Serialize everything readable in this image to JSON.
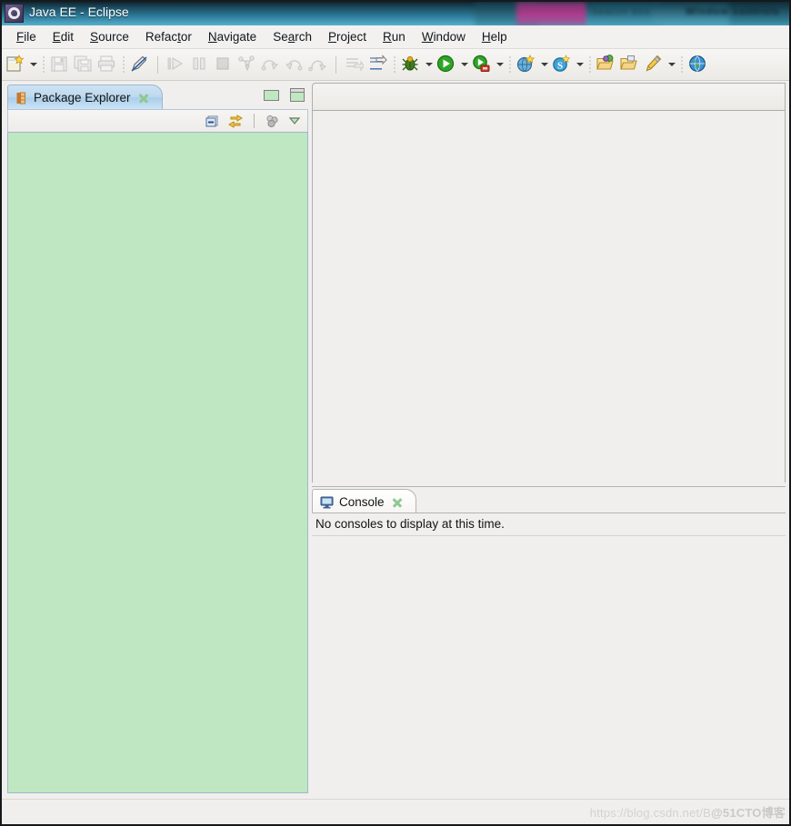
{
  "window": {
    "title": "Java EE - Eclipse",
    "app_icon": "eclipse-icon",
    "titlebar_blurred_text_1": "Search box",
    "titlebar_blurred_text_2": "Window controls"
  },
  "menubar": {
    "items": [
      {
        "label": "File",
        "mnemonic": "F",
        "name": "menu-file"
      },
      {
        "label": "Edit",
        "mnemonic": "E",
        "name": "menu-edit"
      },
      {
        "label": "Source",
        "mnemonic": "S",
        "name": "menu-source"
      },
      {
        "label": "Refactor",
        "mnemonic": "t",
        "name": "menu-refactor"
      },
      {
        "label": "Navigate",
        "mnemonic": "N",
        "name": "menu-navigate"
      },
      {
        "label": "Search",
        "mnemonic": "a",
        "name": "menu-search"
      },
      {
        "label": "Project",
        "mnemonic": "P",
        "name": "menu-project"
      },
      {
        "label": "Run",
        "mnemonic": "R",
        "name": "menu-run"
      },
      {
        "label": "Window",
        "mnemonic": "W",
        "name": "menu-window"
      },
      {
        "label": "Help",
        "mnemonic": "H",
        "name": "menu-help"
      }
    ]
  },
  "toolbar": {
    "items": [
      {
        "name": "new-wizard-button",
        "icon": "new-file-icon",
        "enabled": true,
        "dropdown": true
      },
      {
        "name": "separator-1",
        "icon": "dotted-separator",
        "enabled": true,
        "dropdown": false
      },
      {
        "name": "save-button",
        "icon": "save-icon",
        "enabled": false,
        "dropdown": false
      },
      {
        "name": "save-all-button",
        "icon": "save-all-icon",
        "enabled": false,
        "dropdown": false
      },
      {
        "name": "print-button",
        "icon": "print-icon",
        "enabled": false,
        "dropdown": false
      },
      {
        "name": "separator-2",
        "icon": "dotted-separator",
        "enabled": true,
        "dropdown": false
      },
      {
        "name": "quick-access-button",
        "icon": "pen-icon",
        "enabled": true,
        "dropdown": false
      },
      {
        "name": "separator-3",
        "icon": "solid-separator",
        "enabled": true,
        "dropdown": false
      },
      {
        "name": "resume-button",
        "icon": "resume-icon",
        "enabled": false,
        "dropdown": false
      },
      {
        "name": "suspend-button",
        "icon": "suspend-icon",
        "enabled": false,
        "dropdown": false
      },
      {
        "name": "terminate-button",
        "icon": "terminate-icon",
        "enabled": false,
        "dropdown": false
      },
      {
        "name": "step-into-button",
        "icon": "step-into-icon",
        "enabled": false,
        "dropdown": false
      },
      {
        "name": "step-over-button",
        "icon": "step-over-icon",
        "enabled": false,
        "dropdown": false
      },
      {
        "name": "step-return-button",
        "icon": "step-return-icon",
        "enabled": false,
        "dropdown": false
      },
      {
        "name": "drop-to-frame-button",
        "icon": "drop-to-frame-icon",
        "enabled": false,
        "dropdown": false
      },
      {
        "name": "separator-4",
        "icon": "solid-separator",
        "enabled": true,
        "dropdown": false
      },
      {
        "name": "skip-breakpoints-button",
        "icon": "skip-breakpoints-icon",
        "enabled": false,
        "dropdown": false
      },
      {
        "name": "use-step-filters-button",
        "icon": "step-filters-icon",
        "enabled": true,
        "dropdown": false
      },
      {
        "name": "separator-5",
        "icon": "dotted-separator",
        "enabled": true,
        "dropdown": false
      },
      {
        "name": "debug-button",
        "icon": "debug-bug-icon",
        "enabled": true,
        "dropdown": true
      },
      {
        "name": "run-button",
        "icon": "run-play-icon",
        "enabled": true,
        "dropdown": true
      },
      {
        "name": "run-on-server-button",
        "icon": "run-on-server-icon",
        "enabled": true,
        "dropdown": true
      },
      {
        "name": "separator-6",
        "icon": "dotted-separator",
        "enabled": true,
        "dropdown": false
      },
      {
        "name": "new-web-project-button",
        "icon": "new-web-project-icon",
        "enabled": true,
        "dropdown": true
      },
      {
        "name": "search-button",
        "icon": "search-s-icon",
        "enabled": true,
        "dropdown": true
      },
      {
        "name": "separator-7",
        "icon": "dotted-separator",
        "enabled": true,
        "dropdown": false
      },
      {
        "name": "open-type-button",
        "icon": "open-folder-green-icon",
        "enabled": true,
        "dropdown": false
      },
      {
        "name": "open-task-button",
        "icon": "open-folder-icon",
        "enabled": true,
        "dropdown": false
      },
      {
        "name": "annotation-button",
        "icon": "pencil-icon",
        "enabled": true,
        "dropdown": true
      },
      {
        "name": "separator-8",
        "icon": "dotted-separator",
        "enabled": true,
        "dropdown": false
      },
      {
        "name": "open-browser-button",
        "icon": "globe-icon",
        "enabled": true,
        "dropdown": false
      }
    ]
  },
  "package_explorer": {
    "tab_label": "Package Explorer",
    "tab_icon": "package-explorer-icon",
    "close_icon": "close-icon",
    "minimize_icon": "minimize-icon",
    "maximize_icon": "maximize-icon",
    "toolbar": [
      {
        "name": "collapse-all-button",
        "icon": "collapse-all-icon"
      },
      {
        "name": "link-with-editor-button",
        "icon": "link-with-editor-icon"
      },
      {
        "name": "view-separator",
        "icon": "separator"
      },
      {
        "name": "focus-on-active-button",
        "icon": "focus-task-icon"
      },
      {
        "name": "view-menu-button",
        "icon": "chevron-down-icon"
      }
    ],
    "tree_items": [],
    "background_color": "#bfe7c2"
  },
  "editor": {
    "tabs": [],
    "content": ""
  },
  "console": {
    "tab_label": "Console",
    "tab_icon": "console-monitor-icon",
    "close_icon": "close-icon",
    "message": "No consoles to display at this time."
  },
  "statusbar": {
    "text": ""
  },
  "watermark": {
    "url_text": "https://blog.csdn.net/B",
    "overlay_text": "@51CTO博客"
  },
  "colors": {
    "titlebar_blue": "#2c7a99",
    "tree_green": "#bfe7c2",
    "active_tab_blue": "#bcd8ee",
    "chrome_gray": "#f0efed",
    "text": "#131313"
  }
}
